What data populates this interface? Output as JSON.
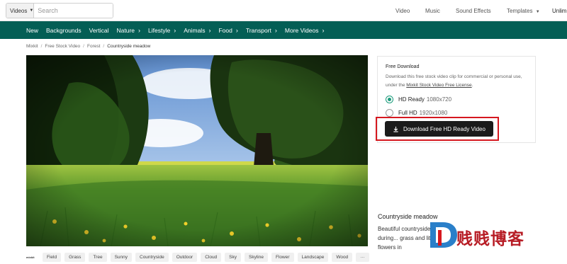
{
  "header": {
    "category_select": "Videos",
    "search_placeholder": "Search",
    "nav": [
      "Video",
      "Music",
      "Sound Effects",
      "Templates",
      "Unlim"
    ]
  },
  "category_nav": [
    "New",
    "Backgrounds",
    "Vertical",
    "Nature",
    "Lifestyle",
    "Animals",
    "Food",
    "Transport",
    "More Videos"
  ],
  "breadcrumb": [
    "Mixkit",
    "Free Stock Video",
    "Forest",
    "Countryside meadow"
  ],
  "download_card": {
    "title": "Free Download",
    "desc_prefix": "Download this free stock video clip for commercial or personal use, under the ",
    "license_link": "Mixkit Stock Video Free License",
    "desc_suffix": ".",
    "options": [
      {
        "label": "HD Ready",
        "res": "1080x720",
        "selected": true
      },
      {
        "label": "Full HD",
        "res": "1920x1080",
        "selected": false
      }
    ],
    "button": "Download Free HD Ready Video"
  },
  "video": {
    "title": "Countryside meadow",
    "description": "Beautiful countryside meadow during... grass and little yellow flowers in"
  },
  "tags": {
    "logo": "mixkit",
    "items": [
      "Field",
      "Grass",
      "Tree",
      "Sunny",
      "Countryside",
      "Outdoor",
      "Cloud",
      "Sky",
      "Skyline",
      "Flower",
      "Landscape",
      "Wood"
    ],
    "more": "···"
  },
  "watermark": "贱贱博客",
  "colors": {
    "nav_bg": "#045e55",
    "accent": "#1a9b7b",
    "highlight": "#d6181f"
  }
}
